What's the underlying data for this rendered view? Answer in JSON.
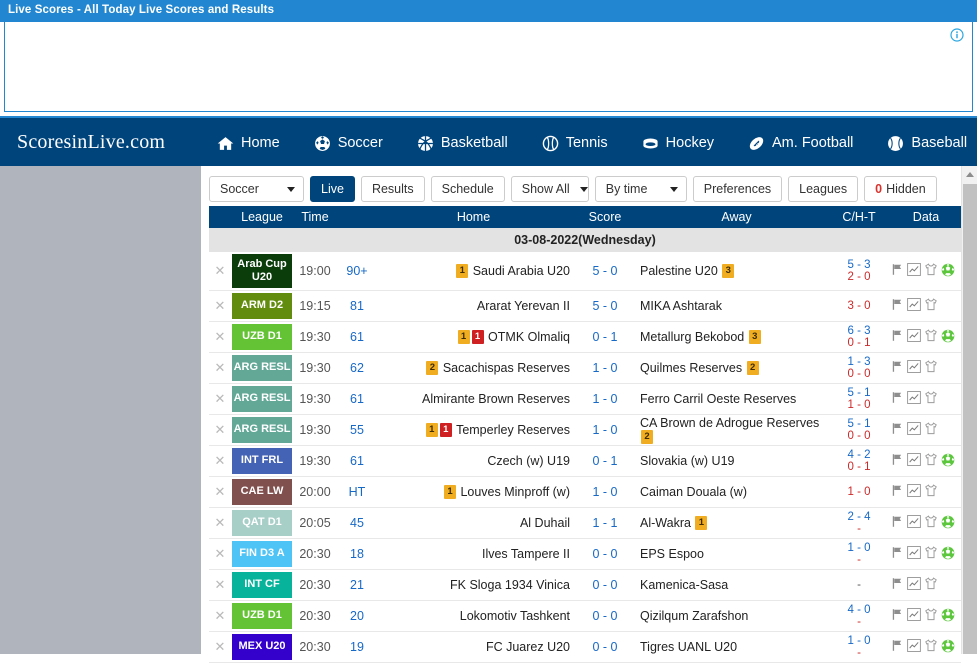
{
  "topbar": {
    "title": "Live Scores - All Today Live Scores and Results",
    "info_icon": "info-icon"
  },
  "nav": {
    "brand": "ScoresinLive.com",
    "items": [
      {
        "label": "Home",
        "icon": "home-icon"
      },
      {
        "label": "Soccer",
        "icon": "soccer-ball-icon"
      },
      {
        "label": "Basketball",
        "icon": "basketball-icon"
      },
      {
        "label": "Tennis",
        "icon": "tennis-ball-icon"
      },
      {
        "label": "Hockey",
        "icon": "hockey-puck-icon"
      },
      {
        "label": "Am. Football",
        "icon": "american-football-icon"
      },
      {
        "label": "Baseball",
        "icon": "baseball-icon"
      }
    ]
  },
  "toolbar": {
    "sport_select": "Soccer",
    "live_btn": "Live",
    "results_btn": "Results",
    "schedule_btn": "Schedule",
    "show_select": "Show All",
    "sort_select": "By time",
    "preferences_btn": "Preferences",
    "leagues_btn": "Leagues",
    "hidden_count": "0",
    "hidden_label": "Hidden"
  },
  "table": {
    "headers": [
      "League",
      "Time",
      "Home",
      "Score",
      "Away",
      "C/H-T",
      "Data"
    ],
    "date_row": "03-08-2022(Wednesday)",
    "close_icon": "close-icon",
    "rows": [
      {
        "league": "Arab Cup U20",
        "league_color": "#0b3d0b",
        "two_line": true,
        "time": "19:00",
        "minute": "90+",
        "home": "Saudi Arabia U20",
        "home_cards": [
          {
            "type": "yellow",
            "n": "1"
          }
        ],
        "score": "5 - 0",
        "away": "Palestine U20",
        "away_cards": [
          {
            "type": "yellow",
            "n": "3"
          }
        ],
        "corners": "5 - 3",
        "ht": "2 - 0",
        "icons": [
          "flag-icon",
          "chart-icon",
          "jersey-icon",
          "soccer-ball-icon"
        ]
      },
      {
        "league": "ARM D2",
        "league_color": "#628c0d",
        "two_line": false,
        "time": "19:15",
        "minute": "81",
        "home": "Ararat Yerevan II",
        "home_cards": [],
        "score": "5 - 0",
        "away": "MIKA Ashtarak",
        "away_cards": [],
        "corners": "",
        "ht": "3 - 0",
        "ht_only": true,
        "icons": [
          "flag-icon",
          "chart-icon",
          "jersey-icon"
        ]
      },
      {
        "league": "UZB D1",
        "league_color": "#64c334",
        "two_line": false,
        "time": "19:30",
        "minute": "61",
        "home": "OTMK Olmaliq",
        "home_cards": [
          {
            "type": "yellow",
            "n": "1"
          },
          {
            "type": "red",
            "n": "1"
          }
        ],
        "score": "0 - 1",
        "away": "Metallurg Bekobod",
        "away_cards": [
          {
            "type": "yellow",
            "n": "3"
          }
        ],
        "corners": "6 - 3",
        "ht": "0 - 1",
        "icons": [
          "flag-icon",
          "chart-icon",
          "jersey-icon",
          "soccer-ball-icon"
        ]
      },
      {
        "league": "ARG RESL",
        "league_color": "#63a897",
        "two_line": false,
        "time": "19:30",
        "minute": "62",
        "home": "Sacachispas Reserves",
        "home_cards": [
          {
            "type": "yellow",
            "n": "2"
          }
        ],
        "score": "1 - 0",
        "away": "Quilmes Reserves",
        "away_cards": [
          {
            "type": "yellow",
            "n": "2"
          }
        ],
        "corners": "1 - 3",
        "ht": "0 - 0",
        "icons": [
          "flag-icon",
          "chart-icon",
          "jersey-icon"
        ]
      },
      {
        "league": "ARG RESL",
        "league_color": "#63a897",
        "two_line": false,
        "time": "19:30",
        "minute": "61",
        "home": "Almirante Brown Reserves",
        "home_cards": [],
        "score": "1 - 0",
        "away": "Ferro Carril Oeste Reserves",
        "away_cards": [],
        "corners": "5 - 1",
        "ht": "1 - 0",
        "icons": [
          "flag-icon",
          "chart-icon",
          "jersey-icon"
        ]
      },
      {
        "league": "ARG RESL",
        "league_color": "#63a897",
        "two_line": false,
        "time": "19:30",
        "minute": "55",
        "home": "Temperley Reserves",
        "home_cards": [
          {
            "type": "yellow",
            "n": "1"
          },
          {
            "type": "red",
            "n": "1"
          }
        ],
        "score": "1 - 0",
        "away": "CA Brown de Adrogue Reserves",
        "away_cards": [
          {
            "type": "yellow",
            "n": "2"
          }
        ],
        "away_cards_below": true,
        "corners": "5 - 1",
        "ht": "0 - 0",
        "icons": [
          "flag-icon",
          "chart-icon",
          "jersey-icon"
        ]
      },
      {
        "league": "INT FRL",
        "league_color": "#4463b4",
        "two_line": false,
        "time": "19:30",
        "minute": "61",
        "home": "Czech (w) U19",
        "home_cards": [],
        "score": "0 - 1",
        "away": "Slovakia (w) U19",
        "away_cards": [],
        "corners": "4 - 2",
        "ht": "0 - 1",
        "icons": [
          "flag-icon",
          "chart-icon",
          "jersey-icon",
          "soccer-ball-icon"
        ]
      },
      {
        "league": "CAE LW",
        "league_color": "#80504f",
        "two_line": false,
        "time": "20:00",
        "minute": "HT",
        "home": "Louves Minproff (w)",
        "home_cards": [
          {
            "type": "yellow",
            "n": "1"
          }
        ],
        "score": "1 - 0",
        "away": "Caiman Douala (w)",
        "away_cards": [],
        "corners": "",
        "ht": "1 - 0",
        "ht_only": true,
        "icons": [
          "flag-icon",
          "chart-icon",
          "jersey-icon"
        ]
      },
      {
        "league": "QAT D1",
        "league_color": "#a8cec8",
        "two_line": false,
        "time": "20:05",
        "minute": "45",
        "home": "Al Duhail",
        "home_cards": [],
        "score": "1 - 1",
        "away": "Al-Wakra",
        "away_cards": [
          {
            "type": "yellow",
            "n": "1"
          }
        ],
        "corners": "2 - 4",
        "ht": "-",
        "icons": [
          "flag-icon",
          "chart-icon",
          "jersey-icon",
          "soccer-ball-icon"
        ]
      },
      {
        "league": "FIN D3 A",
        "league_color": "#4ec3f5",
        "two_line": false,
        "time": "20:30",
        "minute": "18",
        "home": "Ilves Tampere II",
        "home_cards": [],
        "score": "0 - 0",
        "away": "EPS Espoo",
        "away_cards": [],
        "corners": "1 - 0",
        "ht": "-",
        "icons": [
          "flag-icon",
          "chart-icon",
          "jersey-icon",
          "soccer-ball-icon"
        ]
      },
      {
        "league": "INT CF",
        "league_color": "#07b39b",
        "two_line": false,
        "time": "20:30",
        "minute": "21",
        "home": "FK Sloga 1934 Vinica",
        "home_cards": [],
        "score": "0 - 0",
        "away": "Kamenica-Sasa",
        "away_cards": [],
        "corners": "",
        "ht": "-",
        "ht_only": true,
        "dash_only": true,
        "icons": [
          "flag-icon",
          "chart-icon",
          "jersey-icon"
        ]
      },
      {
        "league": "UZB D1",
        "league_color": "#64c334",
        "two_line": false,
        "time": "20:30",
        "minute": "20",
        "home": "Lokomotiv Tashkent",
        "home_cards": [],
        "score": "0 - 0",
        "away": "Qizilqum Zarafshon",
        "away_cards": [],
        "corners": "4 - 0",
        "ht": "-",
        "icons": [
          "flag-icon",
          "chart-icon",
          "jersey-icon",
          "soccer-ball-icon"
        ]
      },
      {
        "league": "MEX U20",
        "league_color": "#3300cc",
        "two_line": false,
        "time": "20:30",
        "minute": "19",
        "home": "FC Juarez U20",
        "home_cards": [],
        "score": "0 - 0",
        "away": "Tigres UANL U20",
        "away_cards": [],
        "corners": "1 - 0",
        "ht": "-",
        "icons": [
          "flag-icon",
          "chart-icon",
          "jersey-icon",
          "soccer-ball-icon"
        ]
      }
    ]
  },
  "colors": {
    "brand_navy": "#00447c",
    "accent_blue": "#2287d0",
    "link_blue": "#1769c7",
    "red": "#cc2a2a",
    "yellow_card": "#f0ad21",
    "red_card": "#cf2121",
    "green_ball": "#5cc63d"
  }
}
